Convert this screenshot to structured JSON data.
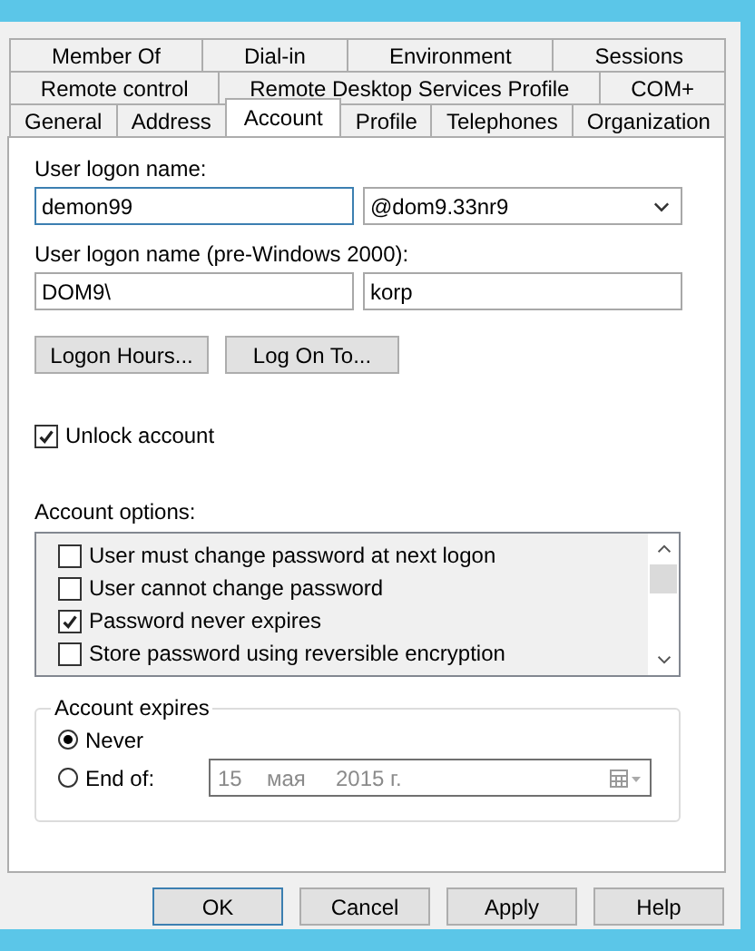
{
  "tab_rows": [
    [
      {
        "label": "Member Of",
        "selected": false
      },
      {
        "label": "Dial-in",
        "selected": false
      },
      {
        "label": "Environment",
        "selected": false
      },
      {
        "label": "Sessions",
        "selected": false
      }
    ],
    [
      {
        "label": "Remote control",
        "selected": false
      },
      {
        "label": "Remote Desktop Services Profile",
        "selected": false
      },
      {
        "label": "COM+",
        "selected": false
      }
    ],
    [
      {
        "label": "General",
        "selected": false
      },
      {
        "label": "Address",
        "selected": false
      },
      {
        "label": "Account",
        "selected": true
      },
      {
        "label": "Profile",
        "selected": false
      },
      {
        "label": "Telephones",
        "selected": false
      },
      {
        "label": "Organization",
        "selected": false
      }
    ]
  ],
  "logon_name": {
    "label": "User logon name:",
    "value": "demon99",
    "domain": "@dom9.33nr9"
  },
  "logon_name_pre2000": {
    "label": "User logon name (pre-Windows 2000):",
    "domain": "DOM9\\",
    "value": "korp"
  },
  "buttons": [
    "Logon Hours...",
    "Log On To..."
  ],
  "unlock_account": {
    "label": "Unlock account",
    "checked": true
  },
  "account_options": {
    "label": "Account options:",
    "items": [
      {
        "label": "User must change password at next logon",
        "checked": false
      },
      {
        "label": "User cannot change password",
        "checked": false
      },
      {
        "label": "Password never expires",
        "checked": true
      },
      {
        "label": "Store password using reversible encryption",
        "checked": false
      }
    ]
  },
  "account_expires": {
    "label": "Account expires",
    "options": [
      {
        "label": "Never",
        "selected": true
      },
      {
        "label": "End of:",
        "selected": false
      }
    ],
    "date": {
      "day": "15",
      "month": "мая",
      "year": "2015 г.",
      "disabled": true
    }
  },
  "dialog_buttons": [
    {
      "label": "OK",
      "default": true
    },
    {
      "label": "Cancel",
      "default": false
    },
    {
      "label": "Apply",
      "default": false
    },
    {
      "label": "Help",
      "default": false
    }
  ]
}
